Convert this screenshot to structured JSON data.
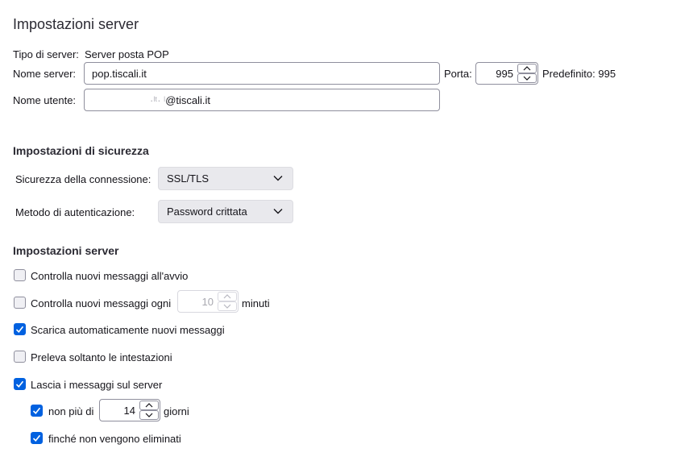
{
  "page_title": "Impostazioni server",
  "server": {
    "type_label": "Tipo di server:",
    "type_value": "Server posta POP",
    "name_label": "Nome server:",
    "name_value": "pop.tiscali.it",
    "port_label": "Porta:",
    "port_value": "995",
    "default_label": "Predefinito: 995",
    "user_label": "Nome utente:",
    "user_masked": "·ˡᵗ· ˡ",
    "user_value": "@tiscali.it"
  },
  "security": {
    "heading": "Impostazioni di sicurezza",
    "connection_label": "Sicurezza della connessione:",
    "connection_value": "SSL/TLS",
    "auth_label": "Metodo di autenticazione:",
    "auth_value": "Password crittata"
  },
  "settings": {
    "heading": "Impostazioni server",
    "check_startup": "Controlla nuovi messaggi all'avvio",
    "check_every": "Controlla nuovi messaggi ogni",
    "check_every_value": "10",
    "check_every_unit": "minuti",
    "auto_download": "Scarica automaticamente nuovi messaggi",
    "headers_only": "Preleva soltanto le intestazioni",
    "leave_on_server": "Lascia i messaggi sul server",
    "max_days_prefix": "non più di",
    "max_days_value": "14",
    "max_days_unit": "giorni",
    "until_deleted": "finché non vengono eliminati"
  },
  "colors": {
    "accent": "#0061e0",
    "border": "#8f8f9d",
    "select_bg": "#e9e9ed"
  }
}
